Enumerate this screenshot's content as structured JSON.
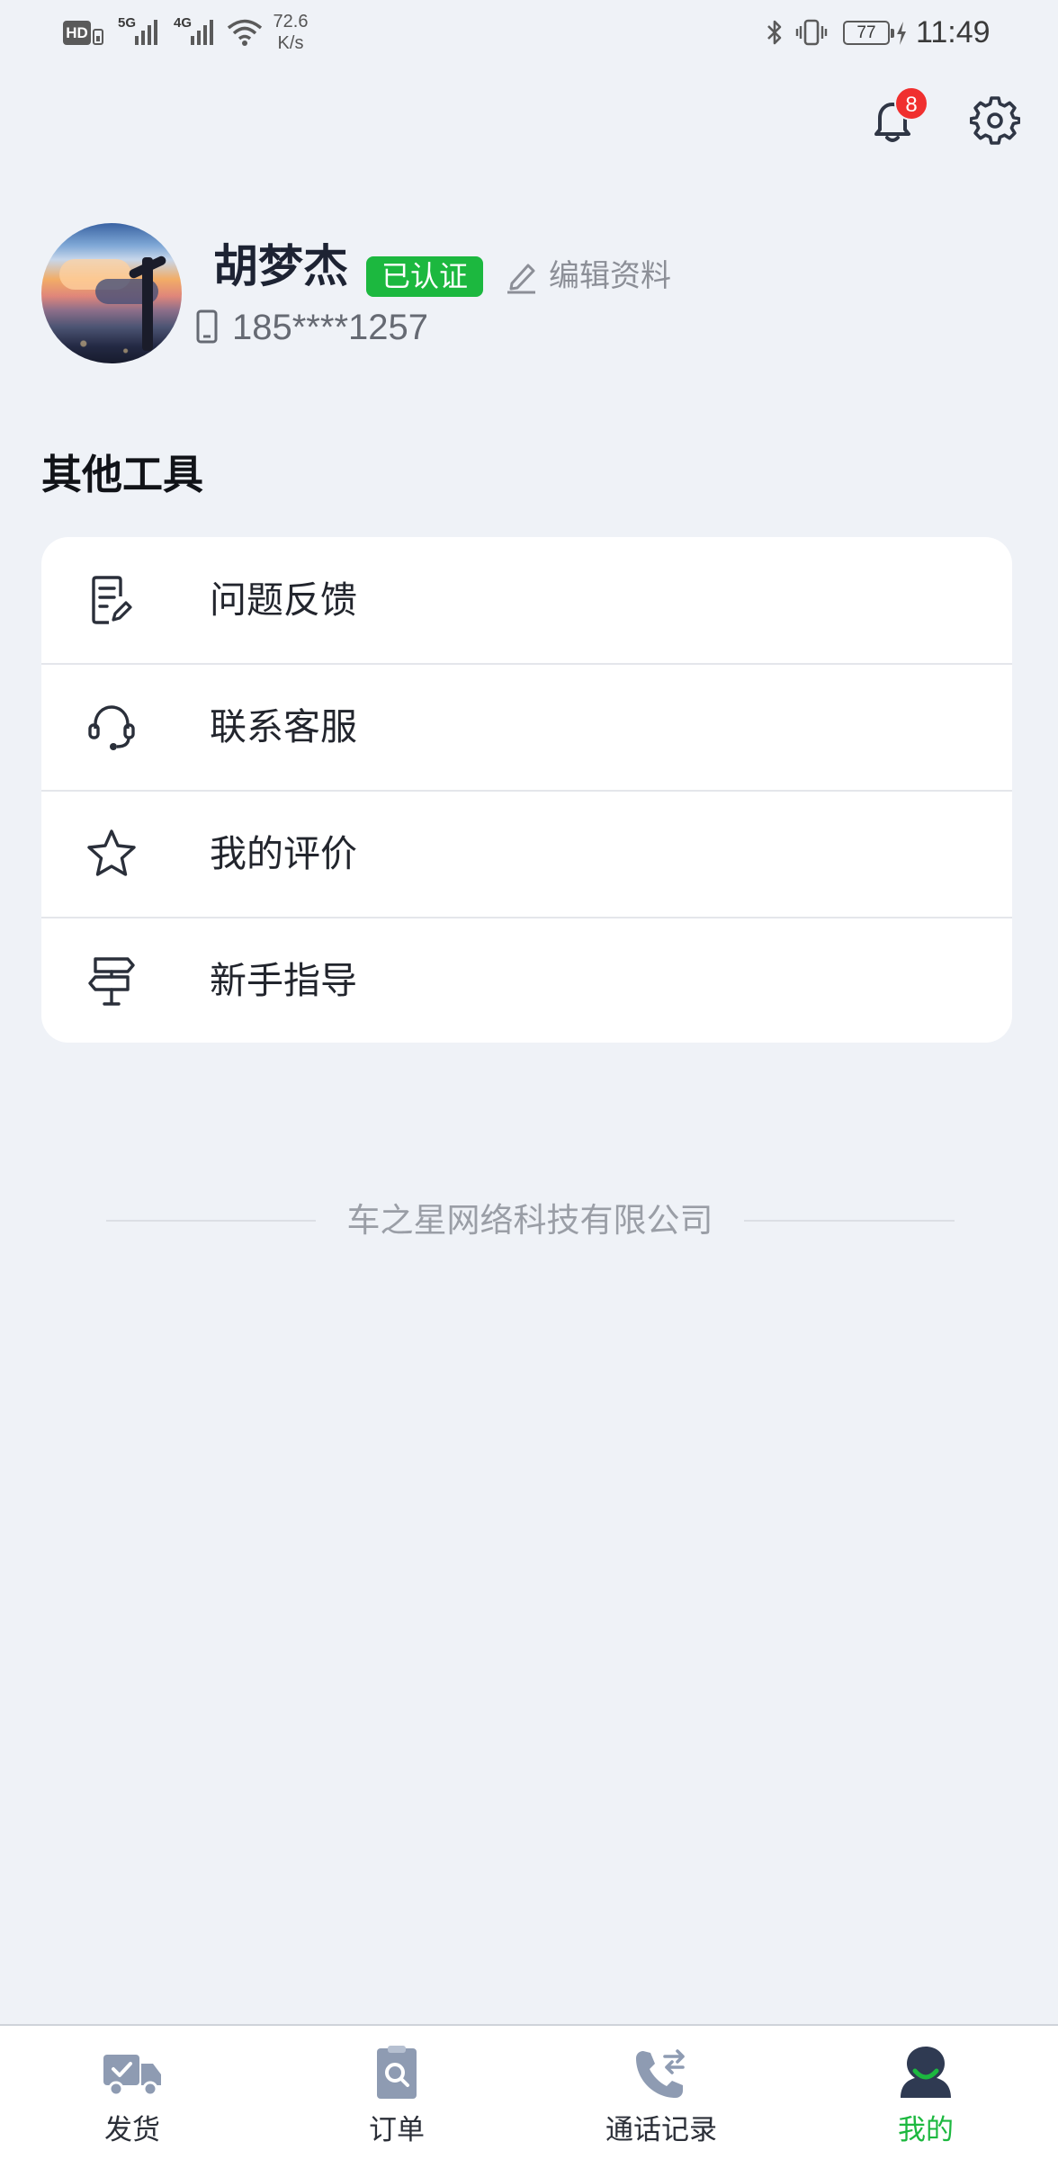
{
  "status_bar": {
    "hd": "HD",
    "network_1": "5G",
    "network_2": "4G",
    "speed_value": "72.6",
    "speed_unit": "K/s",
    "battery": "77",
    "time": "11:49"
  },
  "header": {
    "notification_count": "8",
    "icons": [
      "bell-icon",
      "gear-icon"
    ]
  },
  "profile": {
    "name": "胡梦杰",
    "verified_label": "已认证",
    "edit_label": "编辑资料",
    "phone": "185****1257"
  },
  "tools": {
    "title": "其他工具",
    "items": [
      {
        "label": "问题反馈",
        "icon": "feedback-icon"
      },
      {
        "label": "联系客服",
        "icon": "headset-icon"
      },
      {
        "label": "我的评价",
        "icon": "star-icon"
      },
      {
        "label": "新手指导",
        "icon": "signpost-icon"
      }
    ]
  },
  "footer": {
    "company": "车之星网络科技有限公司"
  },
  "tabbar": {
    "items": [
      {
        "label": "发货",
        "icon": "truck-icon",
        "active": false
      },
      {
        "label": "订单",
        "icon": "order-icon",
        "active": false
      },
      {
        "label": "通话记录",
        "icon": "call-log-icon",
        "active": false
      },
      {
        "label": "我的",
        "icon": "profile-icon",
        "active": true
      }
    ]
  },
  "colors": {
    "accent": "#1cb83f",
    "badge": "#f0302f",
    "background": "#eff2f7",
    "card": "#ffffff",
    "tab_icon_inactive": "#8e9bb2"
  }
}
